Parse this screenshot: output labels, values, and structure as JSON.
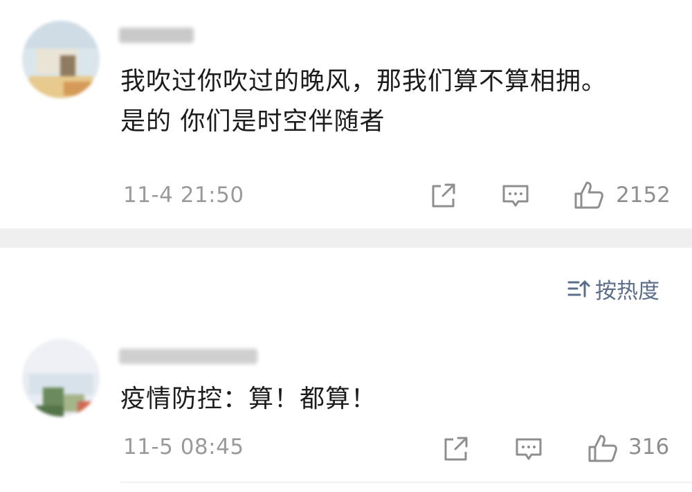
{
  "comments": [
    {
      "text_line1": "我吹过你吹过的晚风，那我们算不算相拥。",
      "text_line2": "是的 你们是时空伴随者",
      "time": "11-4 21:50",
      "likes": "2152"
    },
    {
      "text_line1": "疫情防控：算！都算！",
      "time": "11-5 08:45",
      "likes": "316"
    }
  ],
  "sort": {
    "label": "按热度",
    "icon": "sort-icon"
  },
  "icons": {
    "share": "share-icon",
    "reply": "comment-icon",
    "like": "thumbs-up-icon"
  },
  "colors": {
    "sort_accent": "#5a6e8c",
    "meta_gray": "#9a9a9a",
    "band_gray": "#efefef"
  }
}
